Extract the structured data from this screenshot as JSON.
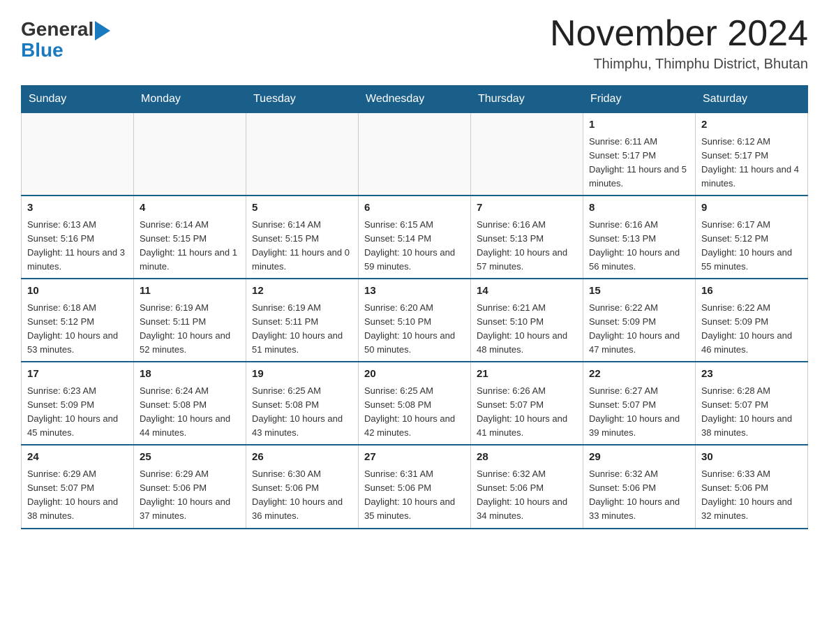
{
  "logo": {
    "general": "General",
    "flag_symbol": "▶",
    "blue": "Blue"
  },
  "title": "November 2024",
  "subtitle": "Thimphu, Thimphu District, Bhutan",
  "days_of_week": [
    "Sunday",
    "Monday",
    "Tuesday",
    "Wednesday",
    "Thursday",
    "Friday",
    "Saturday"
  ],
  "weeks": [
    [
      {
        "day": "",
        "info": ""
      },
      {
        "day": "",
        "info": ""
      },
      {
        "day": "",
        "info": ""
      },
      {
        "day": "",
        "info": ""
      },
      {
        "day": "",
        "info": ""
      },
      {
        "day": "1",
        "info": "Sunrise: 6:11 AM\nSunset: 5:17 PM\nDaylight: 11 hours and 5 minutes."
      },
      {
        "day": "2",
        "info": "Sunrise: 6:12 AM\nSunset: 5:17 PM\nDaylight: 11 hours and 4 minutes."
      }
    ],
    [
      {
        "day": "3",
        "info": "Sunrise: 6:13 AM\nSunset: 5:16 PM\nDaylight: 11 hours and 3 minutes."
      },
      {
        "day": "4",
        "info": "Sunrise: 6:14 AM\nSunset: 5:15 PM\nDaylight: 11 hours and 1 minute."
      },
      {
        "day": "5",
        "info": "Sunrise: 6:14 AM\nSunset: 5:15 PM\nDaylight: 11 hours and 0 minutes."
      },
      {
        "day": "6",
        "info": "Sunrise: 6:15 AM\nSunset: 5:14 PM\nDaylight: 10 hours and 59 minutes."
      },
      {
        "day": "7",
        "info": "Sunrise: 6:16 AM\nSunset: 5:13 PM\nDaylight: 10 hours and 57 minutes."
      },
      {
        "day": "8",
        "info": "Sunrise: 6:16 AM\nSunset: 5:13 PM\nDaylight: 10 hours and 56 minutes."
      },
      {
        "day": "9",
        "info": "Sunrise: 6:17 AM\nSunset: 5:12 PM\nDaylight: 10 hours and 55 minutes."
      }
    ],
    [
      {
        "day": "10",
        "info": "Sunrise: 6:18 AM\nSunset: 5:12 PM\nDaylight: 10 hours and 53 minutes."
      },
      {
        "day": "11",
        "info": "Sunrise: 6:19 AM\nSunset: 5:11 PM\nDaylight: 10 hours and 52 minutes."
      },
      {
        "day": "12",
        "info": "Sunrise: 6:19 AM\nSunset: 5:11 PM\nDaylight: 10 hours and 51 minutes."
      },
      {
        "day": "13",
        "info": "Sunrise: 6:20 AM\nSunset: 5:10 PM\nDaylight: 10 hours and 50 minutes."
      },
      {
        "day": "14",
        "info": "Sunrise: 6:21 AM\nSunset: 5:10 PM\nDaylight: 10 hours and 48 minutes."
      },
      {
        "day": "15",
        "info": "Sunrise: 6:22 AM\nSunset: 5:09 PM\nDaylight: 10 hours and 47 minutes."
      },
      {
        "day": "16",
        "info": "Sunrise: 6:22 AM\nSunset: 5:09 PM\nDaylight: 10 hours and 46 minutes."
      }
    ],
    [
      {
        "day": "17",
        "info": "Sunrise: 6:23 AM\nSunset: 5:09 PM\nDaylight: 10 hours and 45 minutes."
      },
      {
        "day": "18",
        "info": "Sunrise: 6:24 AM\nSunset: 5:08 PM\nDaylight: 10 hours and 44 minutes."
      },
      {
        "day": "19",
        "info": "Sunrise: 6:25 AM\nSunset: 5:08 PM\nDaylight: 10 hours and 43 minutes."
      },
      {
        "day": "20",
        "info": "Sunrise: 6:25 AM\nSunset: 5:08 PM\nDaylight: 10 hours and 42 minutes."
      },
      {
        "day": "21",
        "info": "Sunrise: 6:26 AM\nSunset: 5:07 PM\nDaylight: 10 hours and 41 minutes."
      },
      {
        "day": "22",
        "info": "Sunrise: 6:27 AM\nSunset: 5:07 PM\nDaylight: 10 hours and 39 minutes."
      },
      {
        "day": "23",
        "info": "Sunrise: 6:28 AM\nSunset: 5:07 PM\nDaylight: 10 hours and 38 minutes."
      }
    ],
    [
      {
        "day": "24",
        "info": "Sunrise: 6:29 AM\nSunset: 5:07 PM\nDaylight: 10 hours and 38 minutes."
      },
      {
        "day": "25",
        "info": "Sunrise: 6:29 AM\nSunset: 5:06 PM\nDaylight: 10 hours and 37 minutes."
      },
      {
        "day": "26",
        "info": "Sunrise: 6:30 AM\nSunset: 5:06 PM\nDaylight: 10 hours and 36 minutes."
      },
      {
        "day": "27",
        "info": "Sunrise: 6:31 AM\nSunset: 5:06 PM\nDaylight: 10 hours and 35 minutes."
      },
      {
        "day": "28",
        "info": "Sunrise: 6:32 AM\nSunset: 5:06 PM\nDaylight: 10 hours and 34 minutes."
      },
      {
        "day": "29",
        "info": "Sunrise: 6:32 AM\nSunset: 5:06 PM\nDaylight: 10 hours and 33 minutes."
      },
      {
        "day": "30",
        "info": "Sunrise: 6:33 AM\nSunset: 5:06 PM\nDaylight: 10 hours and 32 minutes."
      }
    ]
  ]
}
